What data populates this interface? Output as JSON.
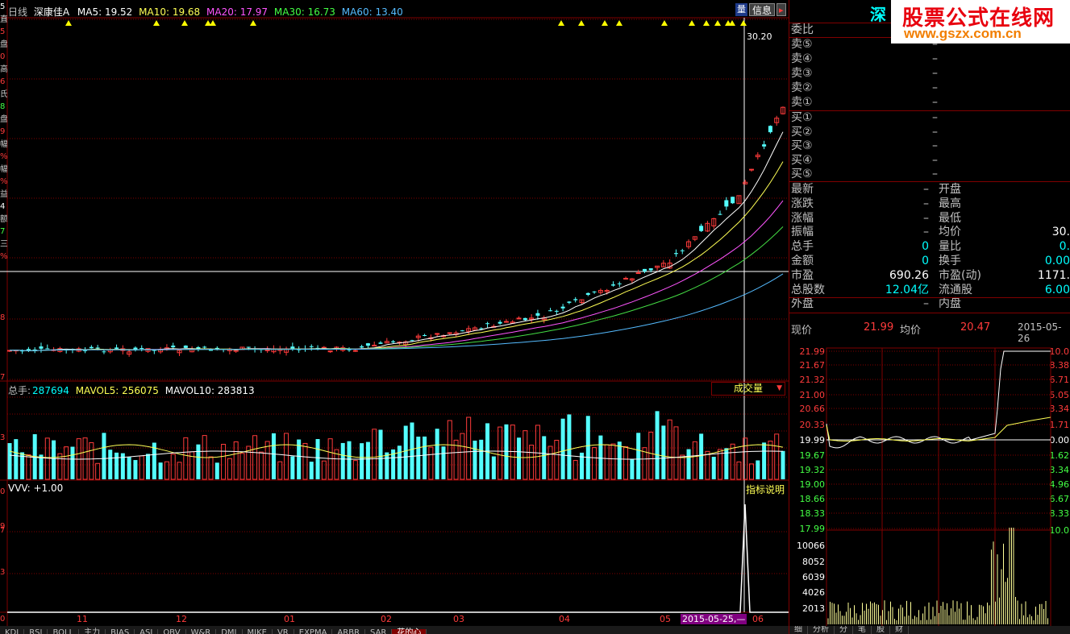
{
  "header": {
    "period": "日线",
    "stock_name": "深康佳A",
    "ma5": "MA5: 19.52",
    "ma10": "MA10: 19.68",
    "ma20": "MA20: 17.97",
    "ma30": "MA30: 16.73",
    "ma60": "MA60: 13.40",
    "info_button": "信息",
    "price_marker": "30.20"
  },
  "left_axis_chars": [
    "5",
    "直",
    "5",
    "盘",
    "0",
    "高",
    "6",
    "氏",
    "8",
    "盘",
    "9",
    "幅",
    "%",
    "幅",
    "%",
    "益",
    "4",
    "额",
    "7",
    "三",
    "%"
  ],
  "left_axis_ticks": [
    "8",
    "7",
    "3",
    "9",
    "0",
    "7",
    "3",
    "0"
  ],
  "volume": {
    "label": "总手:",
    "total": "287694",
    "mavol5": "MAVOL5: 256075",
    "mavol10": "MAVOL10: 283813",
    "dropdown": "成交量"
  },
  "indicator": {
    "label": "VVV: +1.00",
    "help": "指标说明"
  },
  "x_axis": {
    "labels": [
      "11",
      "12",
      "01",
      "02",
      "03",
      "04",
      "05",
      "06"
    ],
    "highlight_date": "2015-05-25,—"
  },
  "bottom_tabs": [
    "KDJ",
    "RSI",
    "BOLL",
    "主力",
    "BIAS",
    "ASI",
    "OBV",
    "W&R",
    "DMI",
    "MIKE",
    "VR",
    "EXPMA",
    "ARBR",
    "SAR",
    "花的心"
  ],
  "right_panel": {
    "code_title": "深",
    "weibi": "委比",
    "sells": [
      "卖⑤",
      "卖④",
      "卖③",
      "卖②",
      "卖①"
    ],
    "buys": [
      "买①",
      "买②",
      "买③",
      "买④",
      "买⑤"
    ],
    "dash": "–",
    "stats": [
      {
        "l1": "最新",
        "v1": "",
        "l2": "开盘",
        "v2": ""
      },
      {
        "l1": "涨跌",
        "v1": "",
        "l2": "最高",
        "v2": ""
      },
      {
        "l1": "涨幅",
        "v1": "",
        "l2": "最低",
        "v2": ""
      },
      {
        "l1": "振幅",
        "v1": "",
        "l2": "均价",
        "v2": "30."
      },
      {
        "l1": "总手",
        "v1": "0",
        "l2": "量比",
        "v2": "0."
      },
      {
        "l1": "金额",
        "v1": "0",
        "l2": "换手",
        "v2": "0.00"
      },
      {
        "l1": "市盈",
        "v1": "690.26",
        "l2": "市盈(动)",
        "v2": "1171."
      },
      {
        "l1": "总股数",
        "v1": "12.04亿",
        "l2": "流通股",
        "v2": "6.00"
      },
      {
        "l1": "外盘",
        "v1": "",
        "l2": "内盘",
        "v2": ""
      }
    ],
    "intraday": {
      "now_label": "现价",
      "now_val": "21.99",
      "avg_label": "均价",
      "avg_val": "20.47",
      "date": "2015-05-26",
      "y_left": [
        "21.99",
        "21.67",
        "21.32",
        "21.00",
        "20.66",
        "20.33",
        "19.99",
        "19.67",
        "19.32",
        "19.00",
        "18.66",
        "18.33",
        "17.99",
        "10066",
        "8052",
        "6039",
        "4026",
        "2013"
      ],
      "y_right": [
        "10.0",
        "8.38",
        "6.71",
        "5.05",
        "3.34",
        "1.71",
        "0.00",
        "1.62",
        "3.34",
        "4.96",
        "6.67",
        "8.33",
        "10.0"
      ],
      "tabs": [
        "细",
        "分析",
        "分",
        "笔",
        "股",
        "财"
      ]
    }
  },
  "watermark": {
    "title": "股票公式在线网",
    "url": "www.gszx.com.cn"
  },
  "colors": {
    "up": "#ff3b3b",
    "down": "#54ffff",
    "ma5": "#ffffff",
    "ma10": "#ffff55",
    "ma20": "#ff55ff",
    "ma30": "#44dd44",
    "ma60": "#55bbff",
    "grid": "#800000"
  }
}
